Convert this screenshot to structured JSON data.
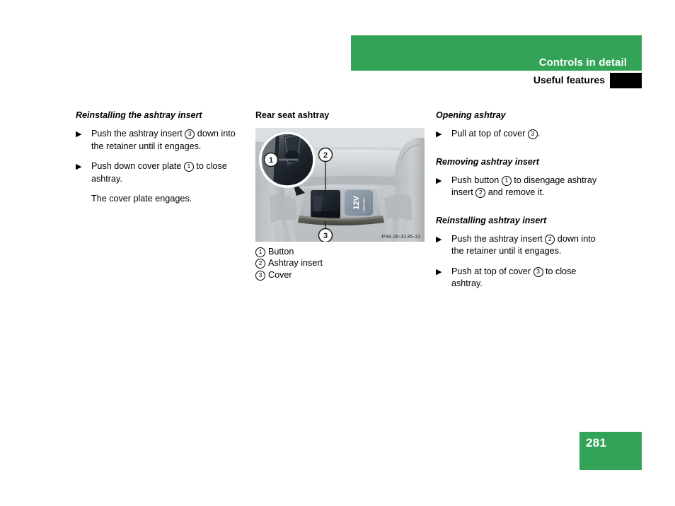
{
  "header": {
    "chapter_title": "Controls in detail",
    "section_title": "Useful features",
    "band_color": "#33a457",
    "tab_color": "#000000"
  },
  "columns": {
    "left": {
      "heading": "Reinstalling the ashtray insert",
      "steps": [
        {
          "marker": "▶",
          "parts": [
            {
              "t": "text",
              "v": "Push the ashtray insert "
            },
            {
              "t": "cnum",
              "v": "3"
            },
            {
              "t": "text",
              "v": " down into the retainer until it engages."
            }
          ]
        },
        {
          "marker": "▶",
          "parts": [
            {
              "t": "text",
              "v": "Push down cover plate "
            },
            {
              "t": "cnum",
              "v": "1"
            },
            {
              "t": "text",
              "v": " to close ashtray."
            }
          ]
        }
      ],
      "note": "The cover plate engages."
    },
    "middle": {
      "heading": "Rear seat ashtray",
      "figure": {
        "code": "P68.20-3135-31",
        "callouts": [
          {
            "label": "1"
          },
          {
            "label": "2"
          },
          {
            "label": "3"
          }
        ],
        "socket_label": "12V",
        "socket_sublabel": "MAX 15A"
      },
      "legend": [
        {
          "num": "1",
          "label": "Button"
        },
        {
          "num": "2",
          "label": "Ashtray insert"
        },
        {
          "num": "3",
          "label": "Cover"
        }
      ]
    },
    "right": {
      "sections": [
        {
          "heading": "Opening ashtray",
          "steps": [
            {
              "marker": "▶",
              "parts": [
                {
                  "t": "text",
                  "v": "Pull at top of cover "
                },
                {
                  "t": "cnum",
                  "v": "3"
                },
                {
                  "t": "text",
                  "v": "."
                }
              ]
            }
          ]
        },
        {
          "heading": "Removing ashtray insert",
          "steps": [
            {
              "marker": "▶",
              "parts": [
                {
                  "t": "text",
                  "v": "Push button "
                },
                {
                  "t": "cnum",
                  "v": "1"
                },
                {
                  "t": "text",
                  "v": " to disengage ashtray insert "
                },
                {
                  "t": "cnum",
                  "v": "2"
                },
                {
                  "t": "text",
                  "v": " and remove it."
                }
              ]
            }
          ]
        },
        {
          "heading": "Reinstalling ashtray insert",
          "steps": [
            {
              "marker": "▶",
              "parts": [
                {
                  "t": "text",
                  "v": "Push the ashtray insert "
                },
                {
                  "t": "cnum",
                  "v": "2"
                },
                {
                  "t": "text",
                  "v": " down into the retainer until it engages."
                }
              ]
            },
            {
              "marker": "▶",
              "parts": [
                {
                  "t": "text",
                  "v": "Push at top of cover "
                },
                {
                  "t": "cnum",
                  "v": "3"
                },
                {
                  "t": "text",
                  "v": " to close ashtray."
                }
              ]
            }
          ]
        }
      ]
    }
  },
  "footer": {
    "page_number": "281",
    "box_color": "#33a457"
  }
}
